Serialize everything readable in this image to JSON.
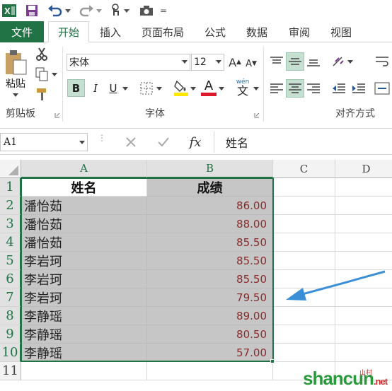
{
  "quick_access": {
    "app_icon": "excel-icon",
    "customize": "="
  },
  "tabs": [
    {
      "label": "文件"
    },
    {
      "label": "开始"
    },
    {
      "label": "插入"
    },
    {
      "label": "页面布局"
    },
    {
      "label": "公式"
    },
    {
      "label": "数据"
    },
    {
      "label": "审阅"
    },
    {
      "label": "视图"
    }
  ],
  "ribbon": {
    "clipboard": {
      "paste_label": "粘贴",
      "group_label": "剪贴板"
    },
    "font": {
      "font_name": "宋体",
      "font_size": "12",
      "group_label": "字体",
      "bold": "B",
      "italic": "I",
      "underline": "U",
      "grow": "A",
      "shrink": "A",
      "font_color": "A",
      "phonetic": "wén",
      "phonetic_char": "文"
    },
    "alignment": {
      "group_label": "对齐方式"
    }
  },
  "formula_bar": {
    "name_box": "A1",
    "fx": "fx",
    "content": "姓名"
  },
  "sheet": {
    "columns": [
      "A",
      "B",
      "C",
      "D"
    ],
    "rows": [
      "1",
      "2",
      "3",
      "4",
      "5",
      "6",
      "7",
      "8",
      "9",
      "10",
      "11"
    ],
    "header": {
      "name": "姓名",
      "score": "成绩"
    },
    "data": [
      {
        "name": "潘怡茹",
        "score": "86.00"
      },
      {
        "name": "潘怡茹",
        "score": "88.00"
      },
      {
        "name": "潘怡茹",
        "score": "85.50"
      },
      {
        "name": "李岩珂",
        "score": "85.50"
      },
      {
        "name": "李岩珂",
        "score": "85.50"
      },
      {
        "name": "李岩珂",
        "score": "79.50"
      },
      {
        "name": "李静瑶",
        "score": "89.00"
      },
      {
        "name": "李静瑶",
        "score": "80.50"
      },
      {
        "name": "李静瑶",
        "score": "57.00"
      }
    ]
  },
  "watermark": {
    "text": "shancun",
    "suffix": ".net",
    "sub": "山村"
  },
  "colors": {
    "accent": "#217346",
    "selection": "#c6c6c6",
    "arrow": "#3b8fd6",
    "score_text": "#8a2a2a"
  }
}
